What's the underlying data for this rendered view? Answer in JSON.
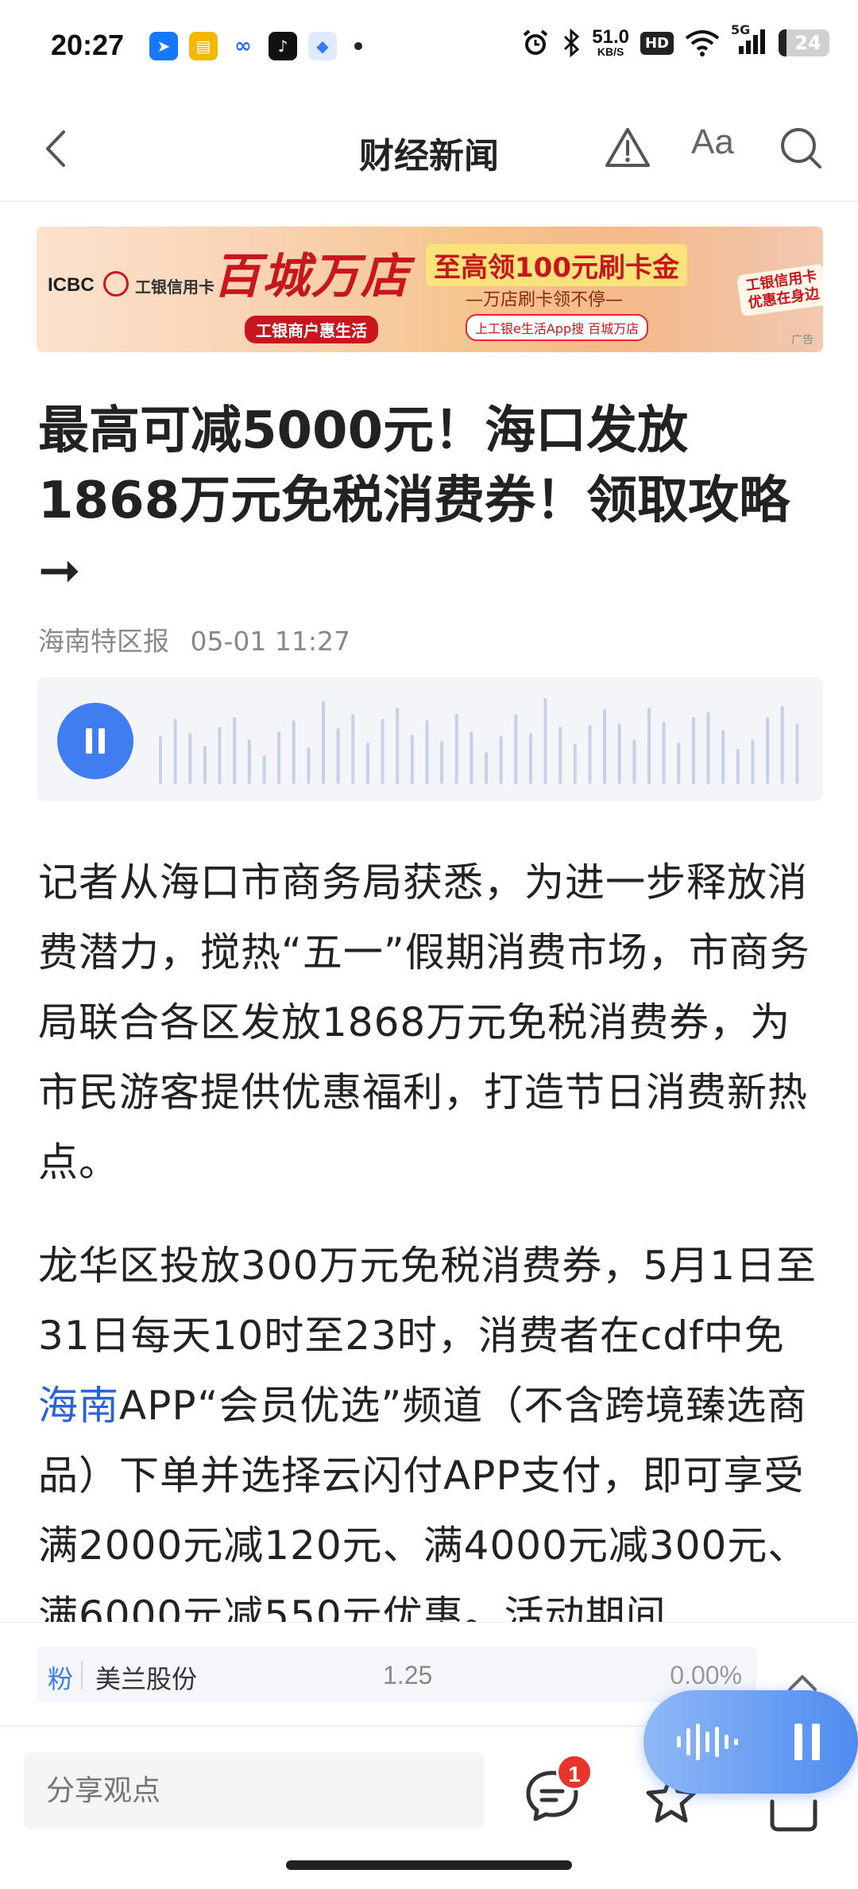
{
  "status_bar": {
    "time": "20:27",
    "net_speed_value": "51.0",
    "net_speed_unit": "KB/S",
    "hd": "HD",
    "signal_label": "5G",
    "battery": "24"
  },
  "nav": {
    "title": "财经新闻",
    "font_label": "Aa"
  },
  "ad": {
    "bank": "ICBC",
    "card": "工银信用卡",
    "headline": "百城万店",
    "merchant": "工银商户惠生活",
    "gold": "至高领100元刷卡金",
    "sub": "—万店刷卡领不停—",
    "search": "上工银e生活App搜 百城万店",
    "badge": "工银信用卡 优惠在身边",
    "tag": "广告"
  },
  "article": {
    "title": "最高可减5000元！海口发放1868万元免税消费券！领取攻略➞",
    "source": "海南特区报",
    "time": "05-01 11:27",
    "p1": "记者从海口市商务局获悉，为进一步释放消费潜力，搅热“五一”假期消费市场，市商务局联合各区发放1868万元免税消费券，为市民游客提供优惠福利，打造节日消费新热点。",
    "p2_a": "龙华区投放300万元免税消费券，5月1日至31日每天10时至23时，消费者在cdf中免",
    "p2_link": "海南",
    "p2_b": "APP“会员优选”频道（不含跨境臻选商品）下单并选择云闪付APP支付，即可享受满2000元减120元、满4000元减300元、满6000元减550元优惠。活动期间"
  },
  "stock": {
    "tag": "粉",
    "name": "美兰股份",
    "price": "1.25",
    "change": "0.00%"
  },
  "bottom": {
    "comment_placeholder": "分享观点",
    "comment_count": "1"
  },
  "colors": {
    "accent": "#3f7df0",
    "link": "#2c62d8",
    "badge": "#e8352b"
  }
}
